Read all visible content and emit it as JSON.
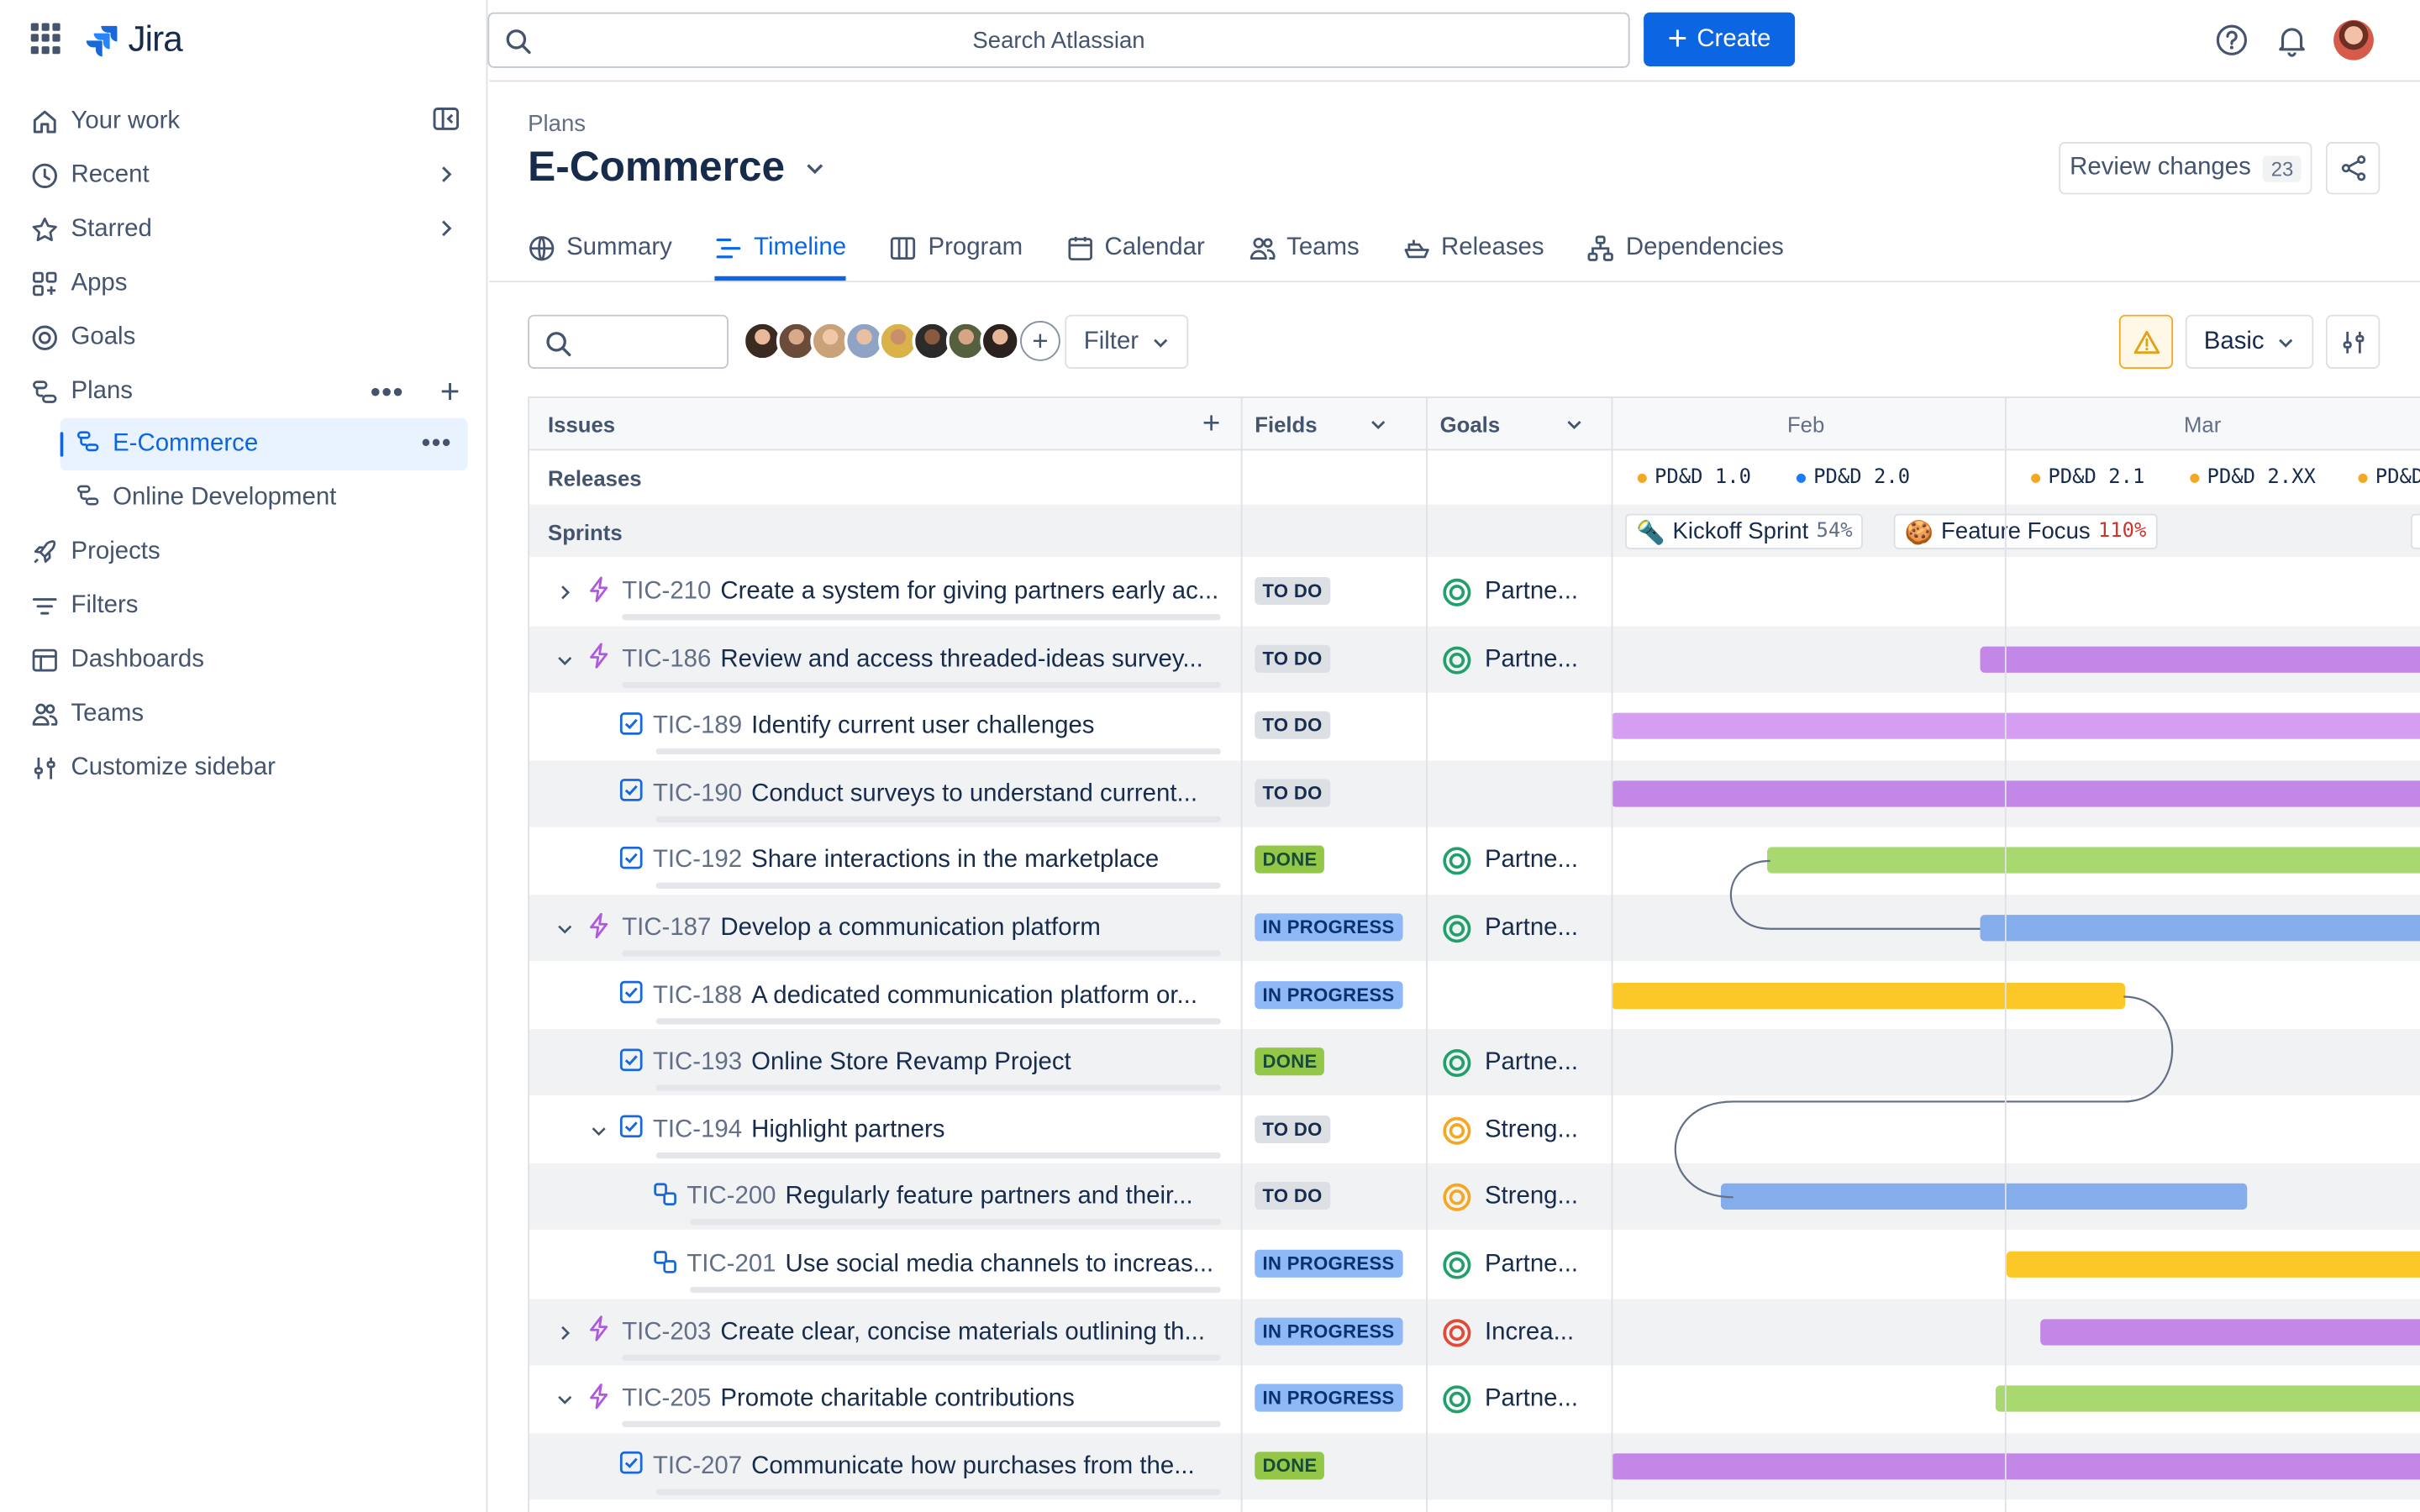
{
  "app": {
    "name": "Jira"
  },
  "search": {
    "placeholder": "Search Atlassian"
  },
  "create_label": "Create",
  "sidebar": {
    "items": [
      {
        "label": "Your work",
        "icon": "home-icon"
      },
      {
        "label": "Recent",
        "icon": "clock-icon"
      },
      {
        "label": "Starred",
        "icon": "star-icon"
      },
      {
        "label": "Apps",
        "icon": "apps-icon"
      },
      {
        "label": "Goals",
        "icon": "goal-icon"
      },
      {
        "label": "Plans",
        "icon": "plans-icon"
      },
      {
        "label": "Projects",
        "icon": "rocket-icon"
      },
      {
        "label": "Filters",
        "icon": "filter-icon"
      },
      {
        "label": "Dashboards",
        "icon": "dashboard-icon"
      },
      {
        "label": "Teams",
        "icon": "people-icon"
      },
      {
        "label": "Customize sidebar",
        "icon": "customize-icon"
      }
    ],
    "plans": [
      {
        "label": "E-Commerce",
        "active": true
      },
      {
        "label": "Online Development",
        "active": false
      }
    ]
  },
  "page": {
    "breadcrumb": "Plans",
    "title": "E-Commerce",
    "review_label": "Review changes",
    "review_count": "23"
  },
  "tabs": [
    {
      "label": "Summary",
      "icon": "globe-icon"
    },
    {
      "label": "Timeline",
      "icon": "timeline-icon",
      "active": true
    },
    {
      "label": "Program",
      "icon": "board-icon"
    },
    {
      "label": "Calendar",
      "icon": "calendar-icon"
    },
    {
      "label": "Teams",
      "icon": "people-icon"
    },
    {
      "label": "Releases",
      "icon": "ship-icon"
    },
    {
      "label": "Dependencies",
      "icon": "hierarchy-icon"
    }
  ],
  "controls": {
    "filter_label": "Filter",
    "view_label": "Basic"
  },
  "table": {
    "headers": {
      "issues": "Issues",
      "fields": "Fields",
      "goals": "Goals"
    },
    "months": [
      "Feb",
      "Mar"
    ],
    "sections": {
      "releases": "Releases",
      "sprints": "Sprints"
    },
    "releases": [
      {
        "name": "PD&D 1.0",
        "color": "#f5a623"
      },
      {
        "name": "PD&D 2.0",
        "color": "#1d7afc"
      },
      {
        "name": "PD&D 2.1",
        "color": "#f5a623"
      },
      {
        "name": "PD&D 2.XX",
        "color": "#f5a623"
      },
      {
        "name": "PD&D",
        "color": "#f5a623"
      }
    ],
    "sprints": [
      {
        "name": "Kickoff Sprint",
        "pct": "54%"
      },
      {
        "name": "Feature Focus",
        "pct": "110%"
      }
    ],
    "rows": [
      {
        "key": "TIC-210",
        "title": "Create a system for giving partners early ac...",
        "type": "epic",
        "chevron": "right",
        "status": "TO DO",
        "goal": "Partne...",
        "goal_color": "#22a06b"
      },
      {
        "key": "TIC-186",
        "title": "Review and access threaded-ideas survey...",
        "type": "epic",
        "chevron": "down",
        "status": "TO DO",
        "goal": "Partne...",
        "goal_color": "#22a06b"
      },
      {
        "key": "TIC-189",
        "title": "Identify current user challenges",
        "type": "task",
        "chevron": "",
        "status": "TO DO",
        "goal": "",
        "goal_color": ""
      },
      {
        "key": "TIC-190",
        "title": "Conduct surveys to understand current...",
        "type": "task",
        "chevron": "",
        "status": "TO DO",
        "goal": "",
        "goal_color": ""
      },
      {
        "key": "TIC-192",
        "title": "Share interactions in the marketplace",
        "type": "task",
        "chevron": "",
        "status": "DONE",
        "goal": "Partne...",
        "goal_color": "#22a06b"
      },
      {
        "key": "TIC-187",
        "title": "Develop a communication platform",
        "type": "epic",
        "chevron": "down",
        "status": "IN PROGRESS",
        "goal": "Partne...",
        "goal_color": "#22a06b"
      },
      {
        "key": "TIC-188",
        "title": "A dedicated communication platform or...",
        "type": "task",
        "chevron": "",
        "status": "IN PROGRESS",
        "goal": "",
        "goal_color": ""
      },
      {
        "key": "TIC-193",
        "title": "Online Store Revamp Project",
        "type": "task",
        "chevron": "",
        "status": "DONE",
        "goal": "Partne...",
        "goal_color": "#22a06b"
      },
      {
        "key": "TIC-194",
        "title": "Highlight partners",
        "type": "task",
        "chevron": "down",
        "status": "TO DO",
        "goal": "Streng...",
        "goal_color": "#f5a623"
      },
      {
        "key": "TIC-200",
        "title": "Regularly feature partners and their...",
        "type": "subtask",
        "chevron": "",
        "status": "TO DO",
        "goal": "Streng...",
        "goal_color": "#f5a623"
      },
      {
        "key": "TIC-201",
        "title": "Use social media channels to increas...",
        "type": "subtask",
        "chevron": "",
        "status": "IN PROGRESS",
        "goal": "Partne...",
        "goal_color": "#22a06b"
      },
      {
        "key": "TIC-203",
        "title": "Create clear, concise materials outlining th...",
        "type": "epic",
        "chevron": "right",
        "status": "IN PROGRESS",
        "goal": "Increa...",
        "goal_color": "#e34935"
      },
      {
        "key": "TIC-205",
        "title": "Promote charitable contributions",
        "type": "epic",
        "chevron": "down",
        "status": "IN PROGRESS",
        "goal": "Partne...",
        "goal_color": "#22a06b"
      },
      {
        "key": "TIC-207",
        "title": "Communicate how purchases from the...",
        "type": "task",
        "chevron": "",
        "status": "DONE",
        "goal": "",
        "goal_color": ""
      }
    ]
  }
}
